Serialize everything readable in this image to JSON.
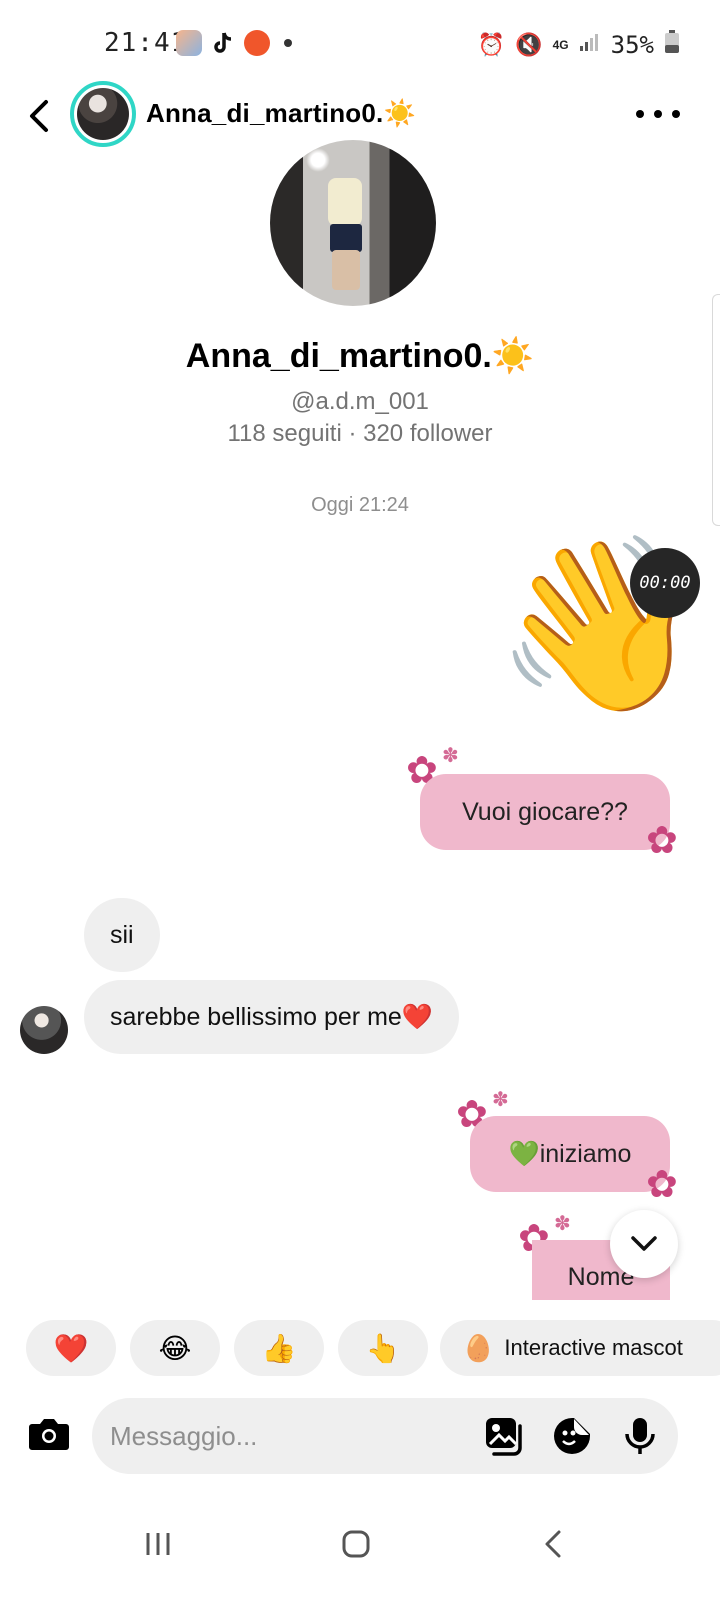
{
  "status_bar": {
    "time": "21:41",
    "network": "4G",
    "battery": "35%"
  },
  "header": {
    "username": "Anna_di_martino0.☀️"
  },
  "profile": {
    "name": "Anna_di_martino0.☀️",
    "handle": "@a.d.m_001",
    "stats": "118 seguiti · 320 follower"
  },
  "conversation": {
    "timestamp": "Oggi 21:24",
    "sticker_emoji": "👋",
    "sticker_timer": "00:00",
    "messages": [
      {
        "direction": "out",
        "text": "Vuoi giocare??"
      },
      {
        "direction": "in",
        "text": "sii"
      },
      {
        "direction": "in",
        "text": "sarebbe bellissimo per me❤️"
      },
      {
        "direction": "out",
        "text": "💚iniziamo"
      },
      {
        "direction": "out",
        "text": "Nome"
      }
    ]
  },
  "quick_reactions": {
    "heart": "❤️",
    "laugh": "😂",
    "thumbs_up": "👍",
    "point_up": "👆",
    "mascot_emoji": "🥚",
    "mascot_label": "Interactive mascot"
  },
  "composer": {
    "placeholder": "Messaggio..."
  },
  "colors": {
    "outgoing_bubble": "#f0b8cc",
    "incoming_bubble": "#efefef",
    "flower": "#c8457d",
    "avatar_ring": "#2fd6c6"
  }
}
